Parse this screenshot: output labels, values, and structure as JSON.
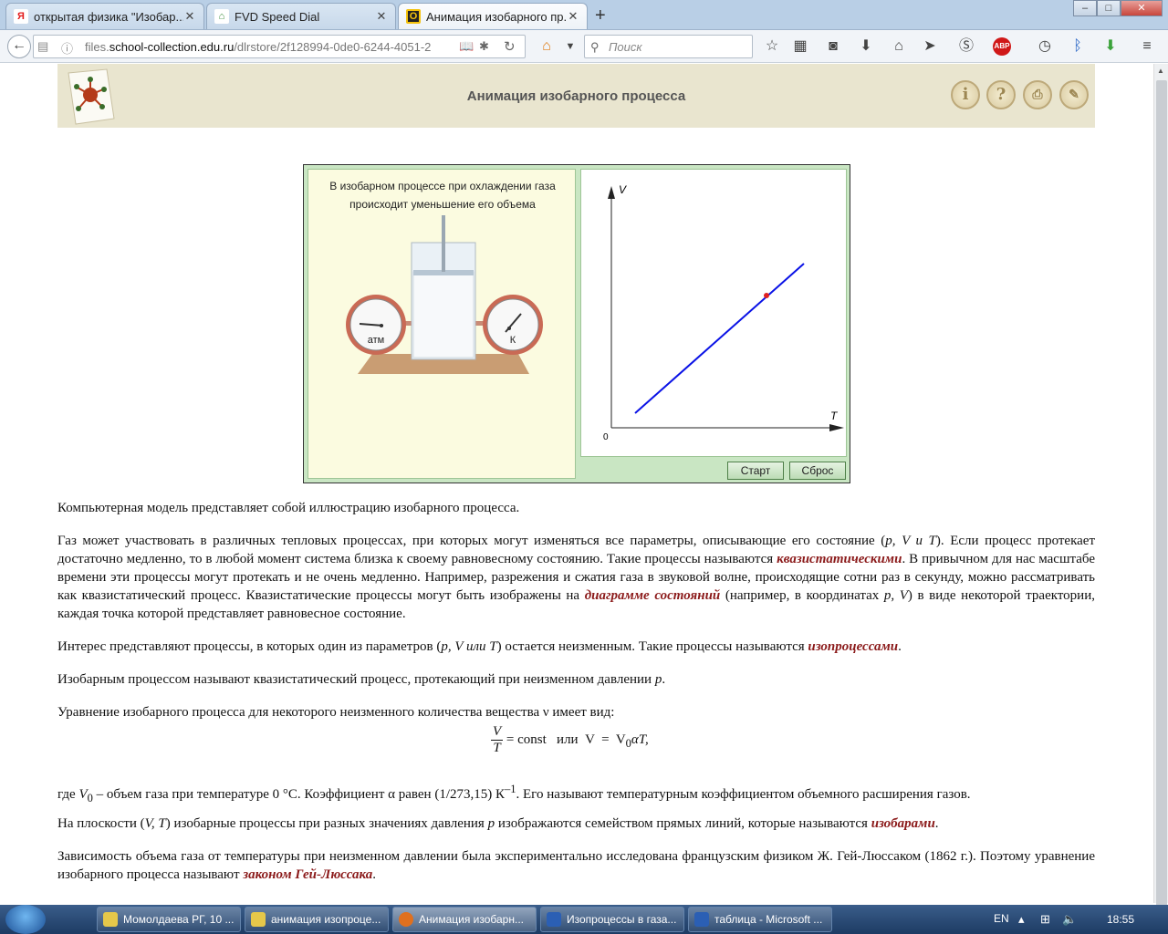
{
  "tabs": [
    {
      "title": "открытая физика \"Изобар...",
      "favicon": "Я",
      "color": "#e21b1b",
      "active": false
    },
    {
      "title": "FVD Speed Dial",
      "favicon": "⌂",
      "color": "#3b8d3b",
      "active": false
    },
    {
      "title": "Анимация изобарного пр...",
      "favicon": "O",
      "color": "#333333",
      "active": true
    }
  ],
  "window_buttons": {
    "minimize": "–",
    "maximize": "□",
    "close": "✕"
  },
  "nav": {
    "url_prefix": "files.",
    "url_domain": "school-collection.edu.ru",
    "url_path": "/dlrstore/2f128994-0de0-6244-4051-2",
    "search_placeholder": "Поиск"
  },
  "header": {
    "title": "Анимация изобарного процесса"
  },
  "animation": {
    "caption_line1": "В изобарном процессе при охлаждении газа",
    "caption_line2": "происходит уменьшение его объема",
    "gauge_left_label": "атм",
    "gauge_right_label": "К",
    "graph": {
      "ylabel": "V",
      "xlabel": "T",
      "origin": "0"
    },
    "start_button": "Старт",
    "reset_button": "Сброс"
  },
  "article": {
    "p1": "Компьютерная модель представляет собой иллюстрацию изобарного процесса.",
    "p2a": "Газ может участвовать в различных тепловых процессах, при которых могут изменяться все параметры, описывающие его состояние (",
    "p2vars": "p, V и T",
    "p2b": "). Если процесс протекает достаточно медленно, то в любой момент система близка к своему равновесному состоянию. Такие процессы называются ",
    "p2term1": "квазистатическими",
    "p2c": ". В привычном для нас масштабе времени эти процессы могут протекать и не очень медленно. Например, разрежения и сжатия газа в звуковой волне, происходящие сотни раз в секунду, можно рассматривать как квазистатический процесс. Квазистатические процессы могут быть изображены на ",
    "p2term2": "диаграмме состояний",
    "p2d": " (например, в координатах ",
    "p2coords": "p, V",
    "p2e": ") в виде некоторой траектории, каждая точка которой представляет равновесное состояние.",
    "p3a": "Интерес представляют процессы, в которых один из параметров (",
    "p3vars": "p, V или T",
    "p3b": ") остается неизменным. Такие процессы называются ",
    "p3term": "изопроцессами",
    "p3c": ".",
    "p4a": "Изобарным процессом называют квазистатический процесс, протекающий при неизменном давлении ",
    "p4var": "p",
    "p4b": ".",
    "p5": "Уравнение изобарного процесса для некоторого неизменного количества вещества ν имеет вид:",
    "formula_num": "V",
    "formula_den": "T",
    "formula_rest": "= const   или  V  =  V",
    "formula_sub": "0",
    "formula_tail": "αT,",
    "p6a": "где ",
    "p6var": "V",
    "p6sub": "0",
    "p6b": " – объем газа при температуре 0 °С. Коэффициент α равен (1/273,15) К",
    "p6sup": "–1",
    "p6c": ". Его называют температурным коэффициентом объемного расширения газов.",
    "p7a": "На плоскости (",
    "p7vars": "V, T",
    "p7b": ") изобарные процессы при разных значениях давления ",
    "p7var": "p",
    "p7c": " изображаются семейством прямых линий, которые называются ",
    "p7term": "изобарами",
    "p7d": ".",
    "p8a": "Зависимость объема газа от температуры при неизменном давлении была экспериментально исследована французским физиком Ж. Гей-Люссаком (1862 г.). Поэтому уравнение изобарного процесса называют ",
    "p8term": "законом Гей-Люссака",
    "p8b": "."
  },
  "taskbar": {
    "items": [
      {
        "label": "Момолдаева РГ, 10 ...",
        "color": "#e6c84a",
        "active": false
      },
      {
        "label": "анимация изопроце...",
        "color": "#e6c84a",
        "active": false
      },
      {
        "label": "Анимация изобарн...",
        "color": "#e0701e",
        "active": true
      },
      {
        "label": "Изопроцессы в газа...",
        "color": "#2b5fb4",
        "active": false
      },
      {
        "label": "таблица - Microsoft ...",
        "color": "#2b5fb4",
        "active": false
      }
    ],
    "language": "EN",
    "clock": "18:55"
  }
}
